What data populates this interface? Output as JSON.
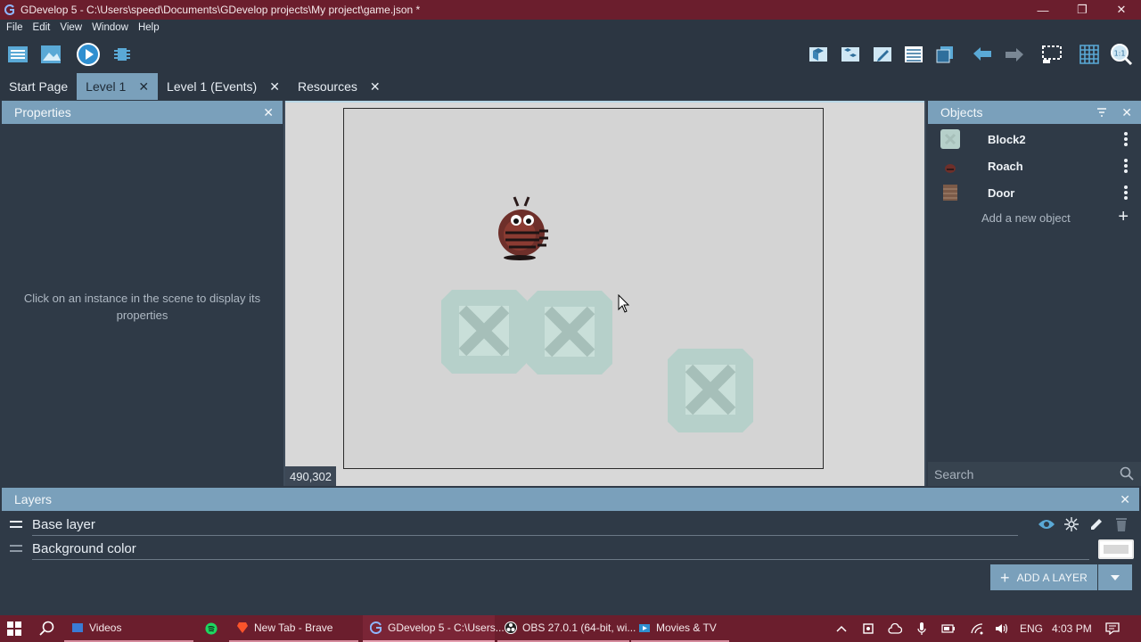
{
  "window": {
    "title": "GDevelop 5 - C:\\Users\\speed\\Documents\\GDevelop projects\\My project\\game.json *",
    "controls": {
      "minimize": "—",
      "restore": "❐",
      "close": "✕"
    }
  },
  "menu": [
    "File",
    "Edit",
    "View",
    "Window",
    "Help"
  ],
  "toolbar": {
    "left_icons": [
      "project-manager-icon",
      "scene-settings-icon",
      "preview-icon",
      "debugger-icon"
    ],
    "right_icons": [
      "objects-panel-icon",
      "object-groups-icon",
      "properties-icon",
      "instances-list-icon",
      "layers-icon",
      "undo-icon",
      "redo-icon",
      "selection-icon",
      "grid-icon",
      "zoom-icon"
    ]
  },
  "tabs": [
    {
      "label": "Start Page",
      "closable": false,
      "active": false
    },
    {
      "label": "Level 1",
      "closable": true,
      "active": true
    },
    {
      "label": "Level 1 (Events)",
      "closable": true,
      "active": false
    },
    {
      "label": "Resources",
      "closable": true,
      "active": false
    }
  ],
  "properties": {
    "title": "Properties",
    "hint": "Click on an instance in the scene to display its properties"
  },
  "scene": {
    "coordinates": "490,302",
    "instances": [
      "Roach",
      "Block2",
      "Block2",
      "Block2"
    ]
  },
  "objects": {
    "title": "Objects",
    "items": [
      {
        "name": "Block2",
        "icon": "block-thumbnail"
      },
      {
        "name": "Roach",
        "icon": "roach-thumbnail"
      },
      {
        "name": "Door",
        "icon": "door-thumbnail"
      }
    ],
    "add_label": "Add a new object",
    "search_placeholder": "Search"
  },
  "layers": {
    "title": "Layers",
    "items": [
      {
        "name": "Base layer"
      },
      {
        "name": "Background color"
      }
    ],
    "add_button": "ADD A LAYER",
    "background_color": "#d8d8d8"
  },
  "taskbar": {
    "apps": [
      {
        "label": "Videos",
        "icon": "videos-icon"
      },
      {
        "label": "",
        "icon": "spotify-icon"
      },
      {
        "label": "New Tab - Brave",
        "icon": "brave-icon"
      },
      {
        "label": "GDevelop 5 - C:\\Users...",
        "icon": "gdevelop-icon"
      },
      {
        "label": "OBS 27.0.1 (64-bit, wi...",
        "icon": "obs-icon"
      },
      {
        "label": "Movies & TV",
        "icon": "movies-tv-icon"
      }
    ],
    "language": "ENG",
    "time": "4:03 PM"
  },
  "colors": {
    "accent": "#7aa0bb",
    "panel_bg": "#2f3a47",
    "titlebar": "#6b1e2d",
    "scene_bg": "#d8d8d8"
  }
}
